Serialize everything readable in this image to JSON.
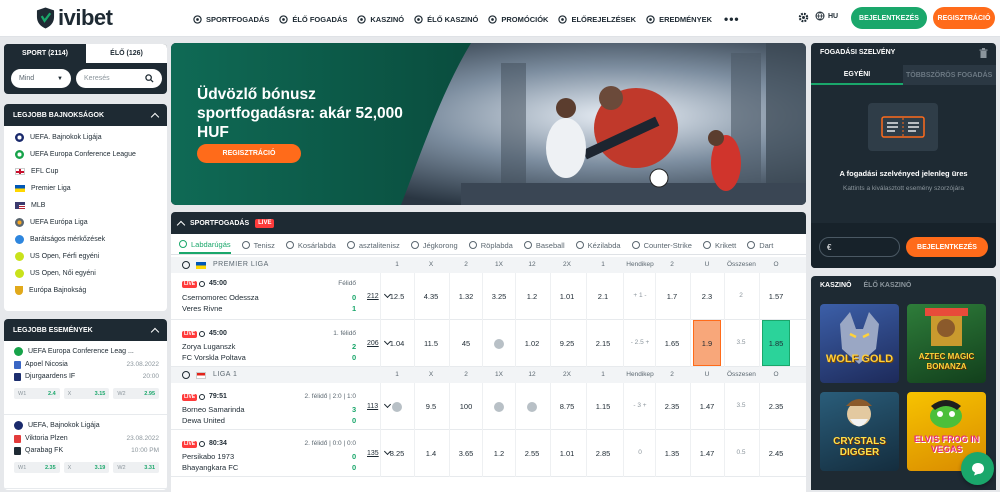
{
  "brand": {
    "name": "ivibet"
  },
  "nav": [
    {
      "label": "SPORTFOGADÁS",
      "icon": "soccer-ball-icon"
    },
    {
      "label": "ÉLŐ FOGADÁS",
      "icon": "flame-icon"
    },
    {
      "label": "KASZINÓ",
      "icon": "spade-icon"
    },
    {
      "label": "ÉLŐ KASZINÓ",
      "icon": "dealer-icon"
    },
    {
      "label": "PROMÓCIÓK",
      "icon": "gift-icon"
    },
    {
      "label": "ELŐREJELZÉSEK",
      "icon": "forecast-icon"
    },
    {
      "label": "EREDMÉNYEK",
      "icon": "trophy-icon"
    }
  ],
  "header": {
    "more": "•••",
    "lang": "HU",
    "login": "BEJELENTKEZÉS",
    "register": "REGISZTRÁCIÓ"
  },
  "sport_tabs": {
    "sport": "SPORT (2114)",
    "live": "ÉLŐ (126)",
    "filter": "Mind",
    "search_placeholder": "Keresés"
  },
  "top_leagues": {
    "title": "LEGJOBB BAJNOKSÁGOK",
    "items": [
      {
        "label": "UEFA. Bajnokok Ligája",
        "icon": "uefa-cl-icon"
      },
      {
        "label": "UEFA Europa Conference League",
        "icon": "uefa-ecl-icon"
      },
      {
        "label": "EFL Cup",
        "icon": "england-flag-icon"
      },
      {
        "label": "Premier Liga",
        "icon": "ukraine-flag-icon"
      },
      {
        "label": "MLB",
        "icon": "usa-flag-icon"
      },
      {
        "label": "UEFA Európa Liga",
        "icon": "uefa-el-icon"
      },
      {
        "label": "Barátságos mérkőzések",
        "icon": "globe-icon"
      },
      {
        "label": "US Open, Férfi egyéni",
        "icon": "tennis-icon"
      },
      {
        "label": "US Open, Női egyéni",
        "icon": "tennis-icon"
      },
      {
        "label": "Európa Bajnokság",
        "icon": "cup-icon"
      }
    ]
  },
  "top_events": {
    "title": "LEGJOBB ESEMÉNYEK",
    "events": [
      {
        "league": "UEFA Europa Conference Leag ...",
        "home": "Apoel Nicosia",
        "away": "Djurgaardens IF",
        "date": "23.08.2022",
        "time": "20:00",
        "odds": [
          {
            "k": "W1",
            "v": "2.4"
          },
          {
            "k": "X",
            "v": "3.15"
          },
          {
            "k": "W2",
            "v": "2.95"
          }
        ]
      },
      {
        "league": "UEFA, Bajnokok Ligája",
        "home": "Viktoria Plzen",
        "away": "Qarabag FK",
        "date": "23.08.2022",
        "time": "10:00 PM",
        "odds": [
          {
            "k": "W1",
            "v": "2.35"
          },
          {
            "k": "X",
            "v": "3.19"
          },
          {
            "k": "W2",
            "v": "3.31"
          }
        ]
      }
    ]
  },
  "banner": {
    "title": "Üdvözlő bónusz sportfogadásra: akár 52,000 HUF",
    "cta": "REGISZTRÁCIÓ"
  },
  "odds": {
    "header_title": "SPORTFOGADÁS",
    "live_label": "LIVE",
    "sports": [
      "Labdarúgás",
      "Tenisz",
      "Kosárlabda",
      "asztalitenisz",
      "Jégkorong",
      "Röplabda",
      "Baseball",
      "Kézilabda",
      "Counter-Strike",
      "Krikett",
      "Dart"
    ],
    "columns": [
      "1",
      "X",
      "2",
      "1X",
      "12",
      "2X",
      "1",
      "Hendikep",
      "2",
      "U",
      "Összesen",
      "O"
    ],
    "leagues": [
      {
        "name": "PREMIER LIGA",
        "flag": "ukraine",
        "matches": [
          {
            "time": "45:00",
            "status": "Félidő",
            "home": "Csernomorec Odessza",
            "away": "Veres Rivne",
            "hs": "0",
            "as": "1",
            "count": "212",
            "odds": [
              "12.5",
              "4.35",
              "1.32",
              "3.25",
              "1.2",
              "1.01",
              "2.1",
              "+ 1 -",
              "1.7",
              "2.3",
              "2",
              "1.57"
            ]
          },
          {
            "time": "45:00",
            "status": "1. félidő",
            "home": "Zorya Luganszk",
            "away": "FC Vorskla Poltava",
            "hs": "2",
            "as": "0",
            "count": "206",
            "odds": [
              "1.04",
              "11.5",
              "45",
              "",
              "1.02",
              "9.25",
              "2.15",
              "- 2.5 +",
              "1.65",
              "1.9",
              "3.5",
              "1.85"
            ]
          }
        ]
      },
      {
        "name": "LIGA 1",
        "flag": "indonesia",
        "matches": [
          {
            "time": "79:51",
            "status": "2. félidő | 2:0 | 1:0",
            "home": "Borneo Samarinda",
            "away": "Dewa United",
            "hs": "3",
            "as": "0",
            "count": "113",
            "odds": [
              "",
              "9.5",
              "100",
              "",
              "",
              "8.75",
              "1.15",
              "- 3 +",
              "2.35",
              "1.47",
              "3.5",
              "2.35"
            ]
          },
          {
            "time": "80:34",
            "status": "2. félidő | 0:0 | 0:0",
            "home": "Persikabo 1973",
            "away": "Bhayangkara FC",
            "hs": "0",
            "as": "0",
            "count": "135",
            "odds": [
              "8.25",
              "1.4",
              "3.65",
              "1.2",
              "2.55",
              "1.01",
              "2.85",
              "0",
              "1.35",
              "1.47",
              "0.5",
              "2.45"
            ]
          }
        ]
      }
    ]
  },
  "betslip": {
    "title": "FOGADÁSI SZELVÉNY",
    "tab_single": "EGYÉNI",
    "tab_multi": "TÖBBSZÖRÖS FOGADÁS",
    "empty_title": "A fogadási szelvényed jelenleg üres",
    "empty_sub": "Kattints a kiválasztott esemény szorzójára",
    "currency": "€",
    "login": "BEJELENTKEZÉS"
  },
  "casino": {
    "tabs": [
      "KASZINÓ",
      "ÉLŐ KASZINÓ"
    ],
    "games": [
      "WOLF GOLD",
      "AZTEC MAGIC BONANZA",
      "CRYSTALS DIGGER",
      "ELVIS FROG IN VEGAS"
    ]
  },
  "colors": {
    "dark": "#1e2a33",
    "accent": "#ff6b1a",
    "green": "#1aa76b",
    "live": "#ff3b3b"
  }
}
